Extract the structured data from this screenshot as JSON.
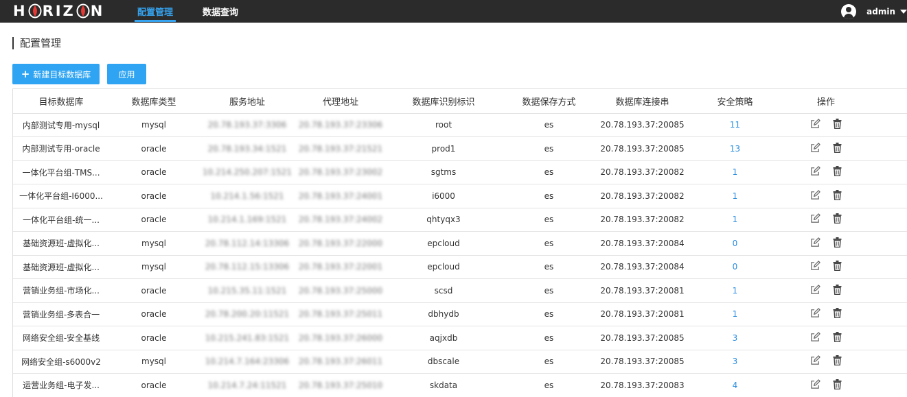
{
  "header": {
    "logo_text": "HORIZON",
    "logo_prefix": "H",
    "logo_mid": "RIZ",
    "logo_suffix": "N",
    "nav": [
      {
        "label": "配置管理",
        "active": true
      },
      {
        "label": "数据查询",
        "active": false
      }
    ],
    "username": "admin"
  },
  "page": {
    "title": "配置管理",
    "new_button": "新建目标数据库",
    "apply_button": "应用"
  },
  "table": {
    "columns": [
      "目标数据库",
      "数据库类型",
      "服务地址",
      "代理地址",
      "数据库识别标识",
      "数据保存方式",
      "数据库连接串",
      "安全策略",
      "操作"
    ],
    "rows": [
      {
        "name": "内部测试专用-mysql",
        "type": "mysql",
        "service": "20.78.193.37:3306",
        "proxy": "20.78.193.37:23306",
        "ident": "root",
        "storage": "es",
        "conn": "20.78.193.37:20085",
        "policy": "11"
      },
      {
        "name": "内部测试专用-oracle",
        "type": "oracle",
        "service": "20.78.193.34:1521",
        "proxy": "20.78.193.37:21521",
        "ident": "prod1",
        "storage": "es",
        "conn": "20.78.193.37:20085",
        "policy": "13"
      },
      {
        "name": "一体化平台组-TMS...",
        "type": "oracle",
        "service": "10.214.250.207:1521",
        "proxy": "20.78.193.37:23002",
        "ident": "sgtms",
        "storage": "es",
        "conn": "20.78.193.37:20082",
        "policy": "1"
      },
      {
        "name": "一体化平台组-I6000...",
        "type": "oracle",
        "service": "10.214.1.56:1521",
        "proxy": "20.78.193.37:24001",
        "ident": "i6000",
        "storage": "es",
        "conn": "20.78.193.37:20082",
        "policy": "1"
      },
      {
        "name": "一体化平台组-统一...",
        "type": "oracle",
        "service": "10.214.1.169:1521",
        "proxy": "20.78.193.37:24002",
        "ident": "qhtyqx3",
        "storage": "es",
        "conn": "20.78.193.37:20082",
        "policy": "1"
      },
      {
        "name": "基础资源班-虚拟化...",
        "type": "mysql",
        "service": "20.78.112.14:13306",
        "proxy": "20.78.193.37:22000",
        "ident": "epcloud",
        "storage": "es",
        "conn": "20.78.193.37:20084",
        "policy": "0"
      },
      {
        "name": "基础资源班-虚拟化...",
        "type": "mysql",
        "service": "20.78.112.15:13306",
        "proxy": "20.78.193.37:22001",
        "ident": "epcloud",
        "storage": "es",
        "conn": "20.78.193.37:20084",
        "policy": "0"
      },
      {
        "name": "营销业务组-市场化...",
        "type": "oracle",
        "service": "10.215.35.11:1521",
        "proxy": "20.78.193.37:25000",
        "ident": "scsd",
        "storage": "es",
        "conn": "20.78.193.37:20081",
        "policy": "1"
      },
      {
        "name": "营销业务组-多表合一",
        "type": "oracle",
        "service": "20.78.200.20:11521",
        "proxy": "20.78.193.37:25011",
        "ident": "dbhydb",
        "storage": "es",
        "conn": "20.78.193.37:20081",
        "policy": "1"
      },
      {
        "name": "网络安全组-安全基线",
        "type": "oracle",
        "service": "10.215.241.83:1521",
        "proxy": "20.78.193.37:26000",
        "ident": "aqjxdb",
        "storage": "es",
        "conn": "20.78.193.37:20085",
        "policy": "3"
      },
      {
        "name": "网络安全组-s6000v2",
        "type": "mysql",
        "service": "10.214.7.164:23306",
        "proxy": "20.78.193.37:26011",
        "ident": "dbscale",
        "storage": "es",
        "conn": "20.78.193.37:20085",
        "policy": "3"
      },
      {
        "name": "运营业务组-电子发...",
        "type": "oracle",
        "service": "10.214.7.24:11521",
        "proxy": "20.78.193.37:25010",
        "ident": "skdata",
        "storage": "es",
        "conn": "20.78.193.37:20083",
        "policy": "4"
      }
    ]
  },
  "icons": {
    "edit": "edit-icon",
    "delete": "trash-icon",
    "user": "user-avatar-icon"
  },
  "colors": {
    "accent": "#2fa4f2",
    "topbar": "#2b2b2b",
    "logo_red": "#e53935",
    "link": "#2b8ee0"
  }
}
